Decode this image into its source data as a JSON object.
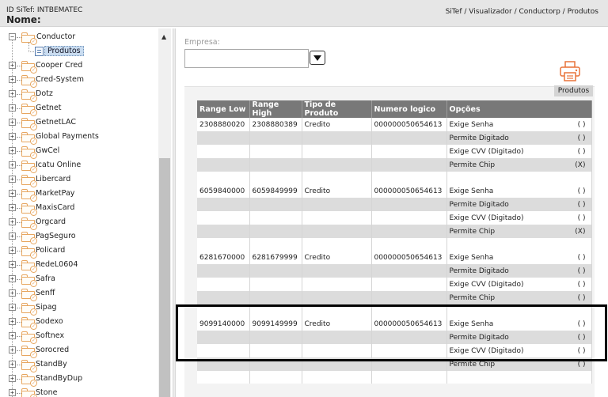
{
  "header": {
    "site_id": "ID SiTef: INTBEMATEC",
    "site_name": "Nome:",
    "breadcrumb": "SiTef / Visualizador / Conductorp / Produtos"
  },
  "tree": {
    "root": {
      "label": "Conductor",
      "expander": "−"
    },
    "child": {
      "label": "Produtos"
    },
    "items": [
      "Cooper Cred",
      "Cred-System",
      "Dotz",
      "Getnet",
      "GetnetLAC",
      "Global Payments",
      "GwCel",
      "Icatu Online",
      "Libercard",
      "MarketPay",
      "MaxisCard",
      "Orgcard",
      "PagSeguro",
      "Policard",
      "RedeL0604",
      "Safra",
      "Senff",
      "Sipag",
      "Sodexo",
      "Softnex",
      "Sorocred",
      "StandBy",
      "StandByDup",
      "Stone"
    ],
    "expander_plus": "+"
  },
  "scroll": {
    "up_arrow": "▲"
  },
  "empresa": {
    "label": "Empresa:",
    "value": ""
  },
  "print": {
    "label": "Produtos"
  },
  "table": {
    "headers": [
      "Range Low",
      "Range High",
      "Tipo de Produto",
      "Numero logico",
      "Opções"
    ],
    "groups": [
      {
        "range_low": "2308880020",
        "range_high": "2308880389",
        "tipo": "Credito",
        "numero": "000000050654613",
        "options": [
          {
            "label": "Exige Senha",
            "mark": "( )"
          },
          {
            "label": "Permite Digitado",
            "mark": "( )"
          },
          {
            "label": "Exige CVV (Digitado)",
            "mark": "( )"
          },
          {
            "label": "Permite Chip",
            "mark": "(X)"
          }
        ]
      },
      {
        "range_low": "6059840000",
        "range_high": "6059849999",
        "tipo": "Credito",
        "numero": "000000050654613",
        "options": [
          {
            "label": "Exige Senha",
            "mark": "( )"
          },
          {
            "label": "Permite Digitado",
            "mark": "( )"
          },
          {
            "label": "Exige CVV (Digitado)",
            "mark": "( )"
          },
          {
            "label": "Permite Chip",
            "mark": "(X)"
          }
        ]
      },
      {
        "range_low": "6281670000",
        "range_high": "6281679999",
        "tipo": "Credito",
        "numero": "000000050654613",
        "options": [
          {
            "label": "Exige Senha",
            "mark": "( )"
          },
          {
            "label": "Permite Digitado",
            "mark": "( )"
          },
          {
            "label": "Exige CVV (Digitado)",
            "mark": "( )"
          },
          {
            "label": "Permite Chip",
            "mark": "( )"
          }
        ]
      },
      {
        "range_low": "9099140000",
        "range_high": "9099149999",
        "tipo": "Credito",
        "numero": "000000050654613",
        "options": [
          {
            "label": "Exige Senha",
            "mark": "( )"
          },
          {
            "label": "Permite Digitado",
            "mark": "( )"
          },
          {
            "label": "Exige CVV (Digitado)",
            "mark": "( )"
          },
          {
            "label": "Permite Chip",
            "mark": "( )"
          }
        ]
      }
    ]
  }
}
